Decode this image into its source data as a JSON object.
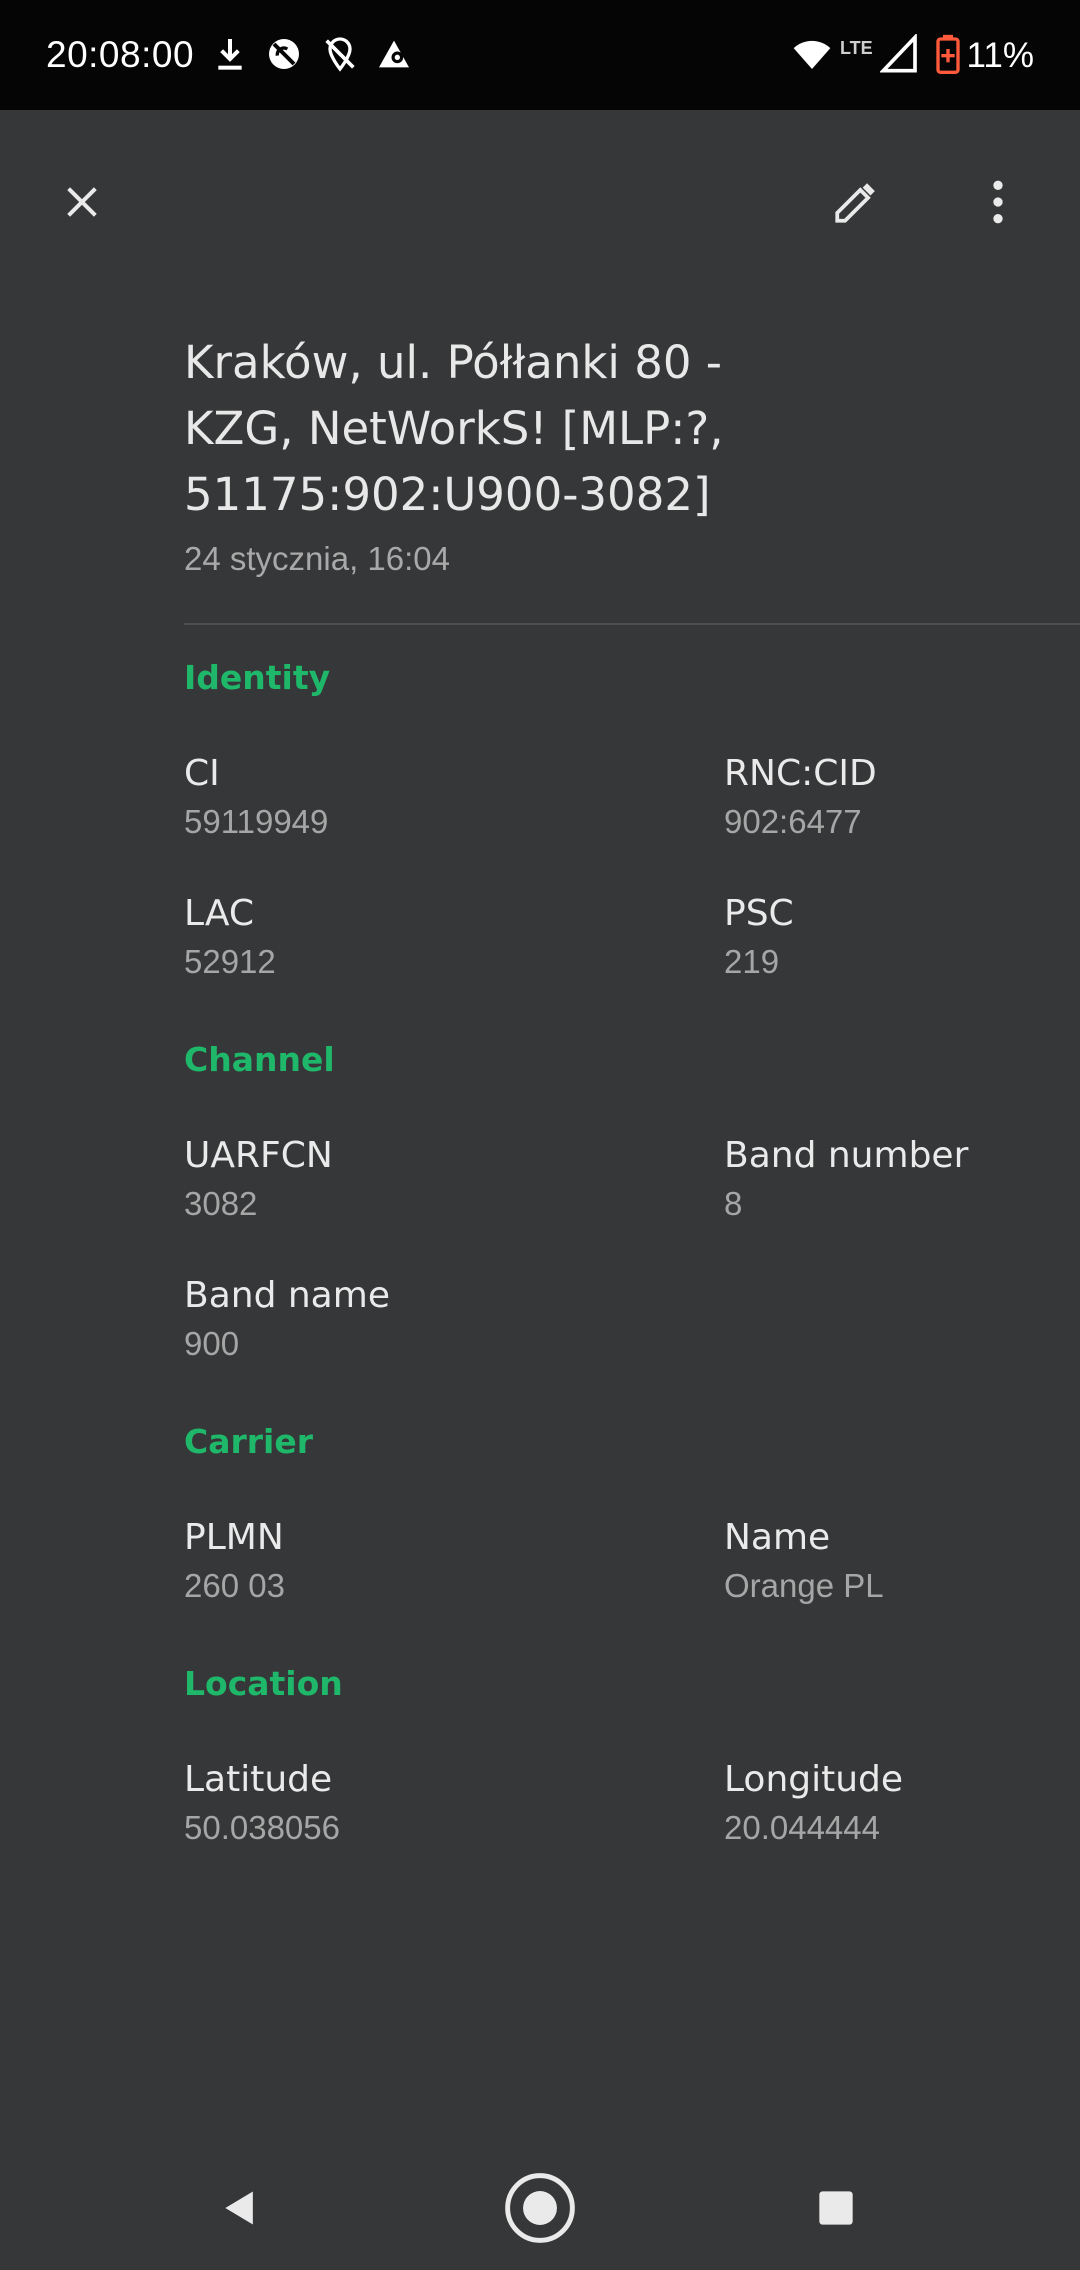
{
  "status_bar": {
    "time": "20:08:00",
    "network_label": "LTE",
    "battery_percent": "11%",
    "battery_color": "#ff5a3c",
    "icons": [
      "download-icon",
      "no-sync-icon",
      "location-off-icon",
      "cellular-app-icon",
      "wifi-icon",
      "signal-icon",
      "battery-icon"
    ]
  },
  "toolbar": {
    "close_icon": "close-icon",
    "edit_icon": "pencil-icon",
    "more_icon": "more-vert-icon"
  },
  "header": {
    "title_lines": [
      "Kraków, ul. Półłanki 80 -",
      "KZG, NetWorkS! [MLP:?,",
      "51175:902:U900-3082]"
    ],
    "subtitle": "24 stycznia, 16:04"
  },
  "sections": {
    "identity": {
      "title": "Identity",
      "ci": {
        "label": "CI",
        "value": "59119949"
      },
      "rnc_cid": {
        "label": "RNC:CID",
        "value": "902:6477"
      },
      "lac": {
        "label": "LAC",
        "value": "52912"
      },
      "psc": {
        "label": "PSC",
        "value": "219"
      }
    },
    "channel": {
      "title": "Channel",
      "uarfcn": {
        "label": "UARFCN",
        "value": "3082"
      },
      "band_number": {
        "label": "Band number",
        "value": "8"
      },
      "band_name": {
        "label": "Band name",
        "value": "900"
      }
    },
    "carrier": {
      "title": "Carrier",
      "plmn": {
        "label": "PLMN",
        "value": "260 03"
      },
      "name": {
        "label": "Name",
        "value": "Orange PL"
      }
    },
    "location": {
      "title": "Location",
      "latitude": {
        "label": "Latitude",
        "value": "50.038056"
      },
      "longitude": {
        "label": "Longitude",
        "value": "20.044444"
      }
    }
  },
  "colors": {
    "accent": "#1fb86a",
    "background": "#363738",
    "status_bar": "#050505"
  },
  "nav_bar": {
    "icons": [
      "back-icon",
      "home-icon",
      "recents-icon"
    ]
  }
}
